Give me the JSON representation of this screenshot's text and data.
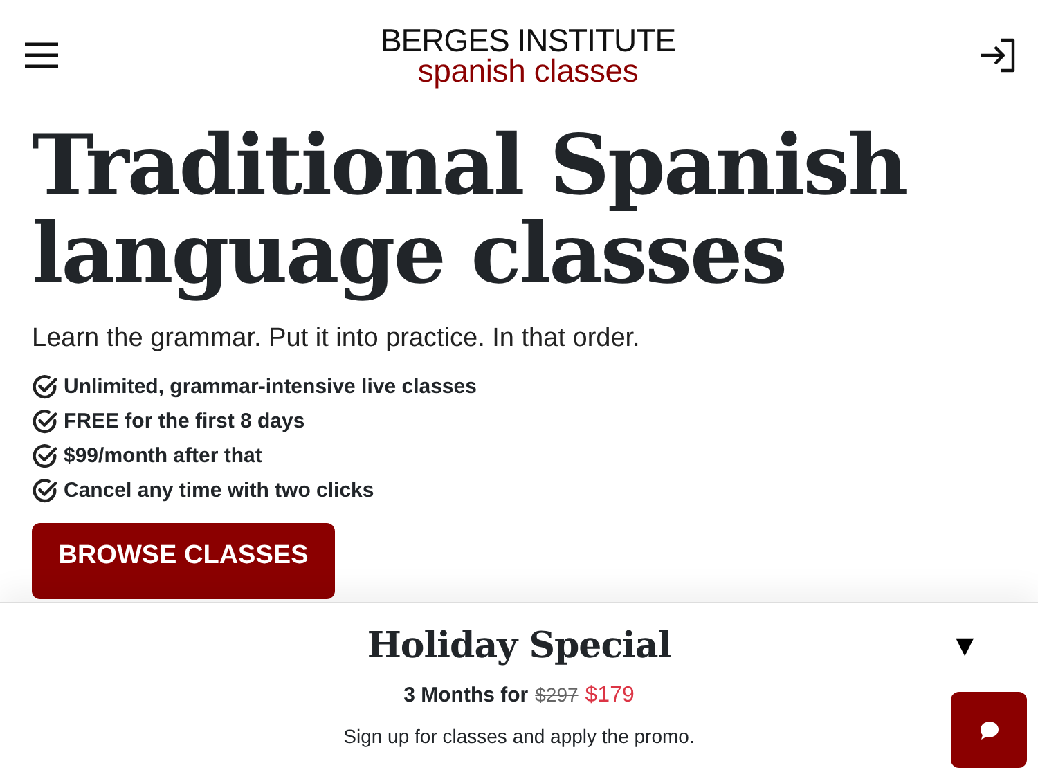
{
  "header": {
    "logo_top": "BERGES INSTITUTE",
    "logo_bottom": "spanish classes"
  },
  "hero": {
    "title_lines": [
      "Traditional Spanish",
      "language classes"
    ],
    "subtitle": "Learn the grammar. Put it into practice. In that order.",
    "features": [
      "Unlimited, grammar-intensive live classes",
      "FREE for the first 8 days",
      "$99/month after that",
      "Cancel any time with two clicks"
    ],
    "button": "BROWSE CLASSES"
  },
  "promo": {
    "title": "Holiday Special",
    "offer": "3 Months for",
    "old_price": "$297",
    "new_price": "$179",
    "note": "Sign up for classes and apply the promo.",
    "toggle": "▼"
  }
}
